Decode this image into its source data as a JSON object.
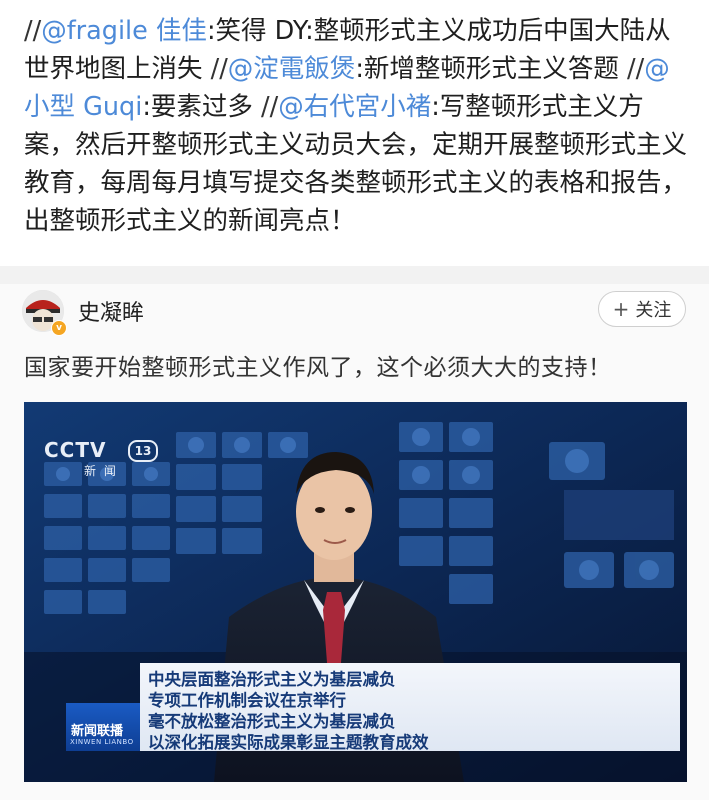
{
  "repost": {
    "segments": [
      {
        "t": "//",
        "k": "sep"
      },
      {
        "t": "@fragile 佳佳",
        "k": "mention"
      },
      {
        "t": ":笑得 DY:整顿形式主义成功后中国大陆从世界地图上消失 ",
        "k": "text"
      },
      {
        "t": "//",
        "k": "sep"
      },
      {
        "t": "@淀電飯煲",
        "k": "mention"
      },
      {
        "t": ":新增整顿形式主义答题 ",
        "k": "text"
      },
      {
        "t": "//",
        "k": "sep"
      },
      {
        "t": "@小型 Guqi",
        "k": "mention"
      },
      {
        "t": ":要素过多 ",
        "k": "text"
      },
      {
        "t": "//",
        "k": "sep"
      },
      {
        "t": "@右代宮小褚",
        "k": "mention"
      },
      {
        "t": ":写整顿形式主义方案，然后开整顿形式主义动员大会，定期开展整顿形式主义教育，每周每月填写提交各类整顿形式主义的表格和报告，出整顿形式主义的新闻亮点！",
        "k": "text"
      }
    ]
  },
  "original_post": {
    "username": "史凝眸",
    "follow_label": "关注",
    "follow_icon": "plus-icon",
    "verified_icon": "verified-badge-icon",
    "text": "国家要开始整顿形式主义作风了，这个必须大大的支持！"
  },
  "video": {
    "channel_logo": "CCTV",
    "channel_number": "13",
    "channel_sub": "新 闻",
    "ticker_lines": [
      "中央层面整治形式主义为基层减负",
      "专项工作机制会议在京举行",
      "毫不放松整治形式主义为基层减负",
      "以深化拓展实际成果彰显主题教育成效"
    ],
    "program_logo": "新闻联播",
    "program_logo_sub": "XINWEN LIANBO"
  },
  "colors": {
    "mention": "#4d8ad8",
    "divider": "#f2f2f2",
    "ticker_text": "#163a78",
    "studio_bg": "#0a1a3a"
  }
}
